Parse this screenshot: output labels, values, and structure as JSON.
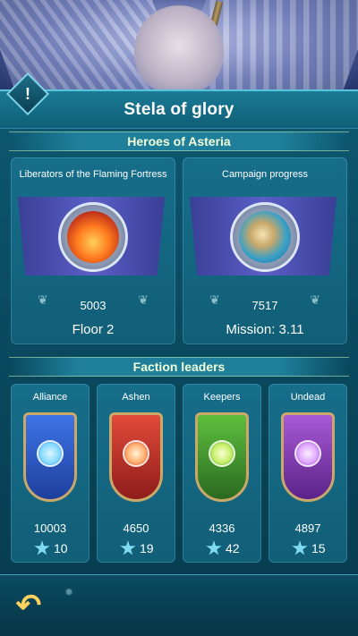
{
  "header": {
    "title": "Stela of glory",
    "alert_icon": "!"
  },
  "heroes_section": {
    "title": "Heroes of Asteria",
    "cards": [
      {
        "label": "Liberators of the Flaming Fortress",
        "value": "5003",
        "sub": "Floor 2",
        "image": "flaming-fortress-medal"
      },
      {
        "label": "Campaign progress",
        "value": "7517",
        "sub": "Mission: 3.11",
        "image": "campaign-map-medal"
      }
    ]
  },
  "faction_section": {
    "title": "Faction leaders",
    "leaders": [
      {
        "name": "Alliance",
        "value": "10003",
        "stars": "10",
        "color": "#2f5fd0",
        "emblem": "#7fd8ff"
      },
      {
        "name": "Ashen",
        "value": "4650",
        "stars": "19",
        "color": "#c8302a",
        "emblem": "#ffb070"
      },
      {
        "name": "Keepers",
        "value": "4336",
        "stars": "42",
        "color": "#3d9b2f",
        "emblem": "#c8f06a"
      },
      {
        "name": "Undead",
        "value": "4897",
        "stars": "15",
        "color": "#8a3fc0",
        "emblem": "#e0a8ff"
      }
    ]
  },
  "icons": {
    "back": "back-arrow-icon",
    "settings": "gear-icon",
    "star": "star-icon",
    "laurel": "laurel-icon"
  }
}
